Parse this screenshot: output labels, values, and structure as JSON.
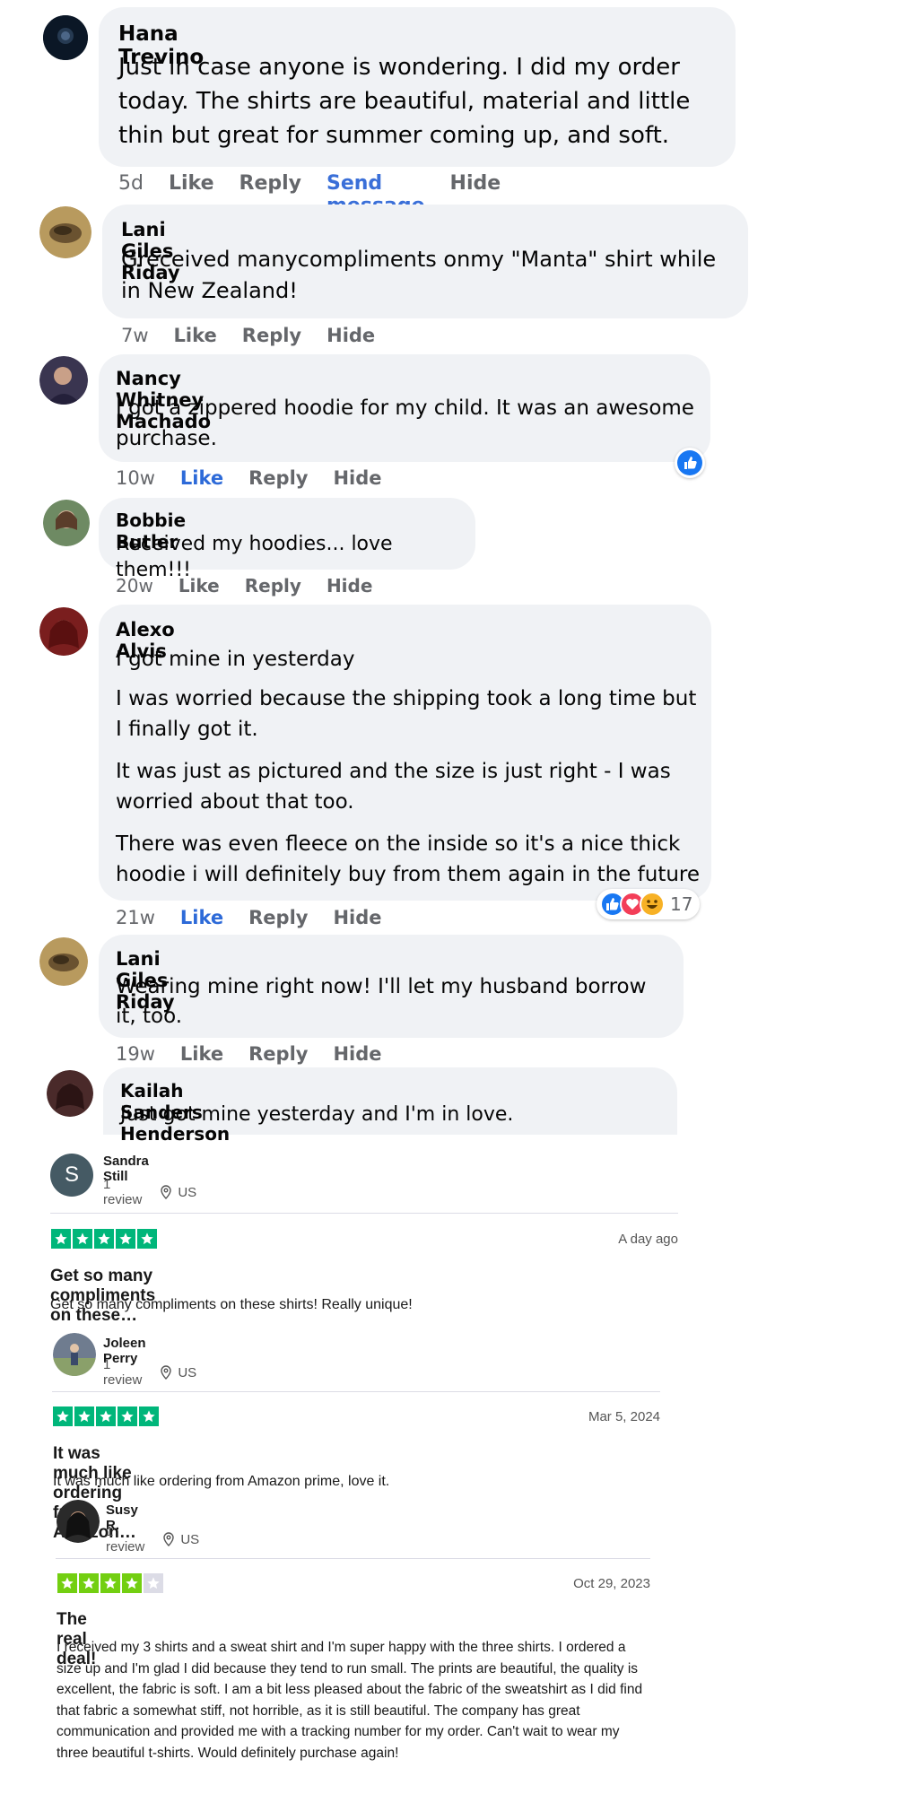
{
  "comments": [
    {
      "name": "Hana Trevino",
      "text": "Just in case anyone is wondering. I did my order today. The shirts are beautiful, material and little thin but great for summer coming up, and soft.",
      "time": "5d",
      "like": "Like",
      "reply": "Reply",
      "send_message": "Send message",
      "hide": "Hide"
    },
    {
      "name": "Lani Giles Riday",
      "text": "Greceived manycompliments onmy \"Manta\" shirt while in New Zealand!",
      "time": "7w",
      "like": "Like",
      "reply": "Reply",
      "hide": "Hide"
    },
    {
      "name": "Nancy Whitney Machado",
      "text": "I got a zippered hoodie for my child. It was an awesome purchase.",
      "time": "10w",
      "like": "Like",
      "reply": "Reply",
      "hide": "Hide",
      "reaction": "like"
    },
    {
      "name": "Bobbie Butler",
      "text": "Received my hoodies... love them!!!",
      "time": "20w",
      "like": "Like",
      "reply": "Reply",
      "hide": "Hide"
    },
    {
      "name": "Alexo Alvis",
      "paragraphs": [
        "I got mine in yesterday",
        "I was worried because the shipping took a long time but I finally got it.",
        "It was just as pictured and the size is just right - I was worried about that too.",
        "There was even fleece on the inside so it's a nice thick hoodie i will definitely buy from them again in the future"
      ],
      "time": "21w",
      "like": "Like",
      "reply": "Reply",
      "hide": "Hide",
      "reactions": [
        "like",
        "love",
        "haha"
      ],
      "reaction_count": "17"
    },
    {
      "name": "Lani Giles Riday",
      "text": "Wearing mine right now! I'll let my husband borrow it, too.",
      "time": "19w",
      "like": "Like",
      "reply": "Reply",
      "hide": "Hide"
    },
    {
      "name": "Kailah Sanders Henderson",
      "text": "Just got mine yesterday and I'm in love."
    }
  ],
  "reviews": [
    {
      "name": "Sandra Still",
      "avatar_initial": "S",
      "review_count": "1 review",
      "country": "US",
      "stars": 5,
      "date": "A day ago",
      "title": "Get so many compliments on these…",
      "body": "Get so many compliments on these shirts! Really unique!"
    },
    {
      "name": "Joleen Perry",
      "review_count": "1 review",
      "country": "US",
      "stars": 5,
      "date": "Mar 5, 2024",
      "title": "It was much like ordering from Amazon…",
      "body": "It was much like ordering from Amazon prime, love it."
    },
    {
      "name": "Susy R.",
      "review_count": "1 review",
      "country": "US",
      "stars": 4,
      "date": "Oct 29, 2023",
      "title": "The real deal!",
      "body": "I received my 3 shirts and a sweat shirt and I'm super happy with the three shirts. I ordered a size up and I'm glad I did because they tend to run small. The prints are beautiful, the quality is excellent, the fabric is soft. I am a bit less pleased about the fabric of the sweatshirt as I did find that fabric a somewhat stiff, not horrible, as it is still beautiful. The company has great communication and provided me with a tracking number for my order. Can't wait to wear my three beautiful t-shirts. Would definitely purchase again!"
    }
  ],
  "colors": {
    "bubble": "#f0f2f5",
    "link_blue": "#3a6fd8",
    "tp_green": "#00b67a",
    "tp_lime": "#73cf11",
    "star_empty": "#dcdce6"
  },
  "icons": [
    "location-pin-icon",
    "star-icon",
    "like-reaction-icon",
    "love-reaction-icon",
    "haha-reaction-icon"
  ]
}
